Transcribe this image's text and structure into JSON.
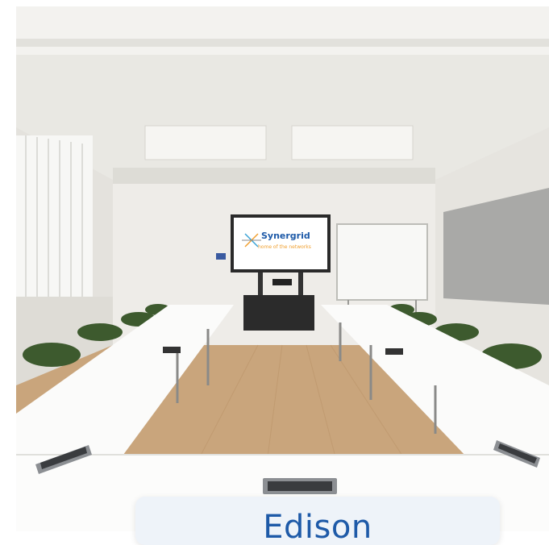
{
  "photo": {
    "screen_brand": "Synergrid",
    "screen_tagline": "home of the networks"
  },
  "room_card": {
    "title": "Edison"
  },
  "colors": {
    "accent": "#1e5aa8",
    "card_background": "#eef3f9",
    "chair_green": "#3d5a2e",
    "floor_wood": "#c9a57c"
  }
}
